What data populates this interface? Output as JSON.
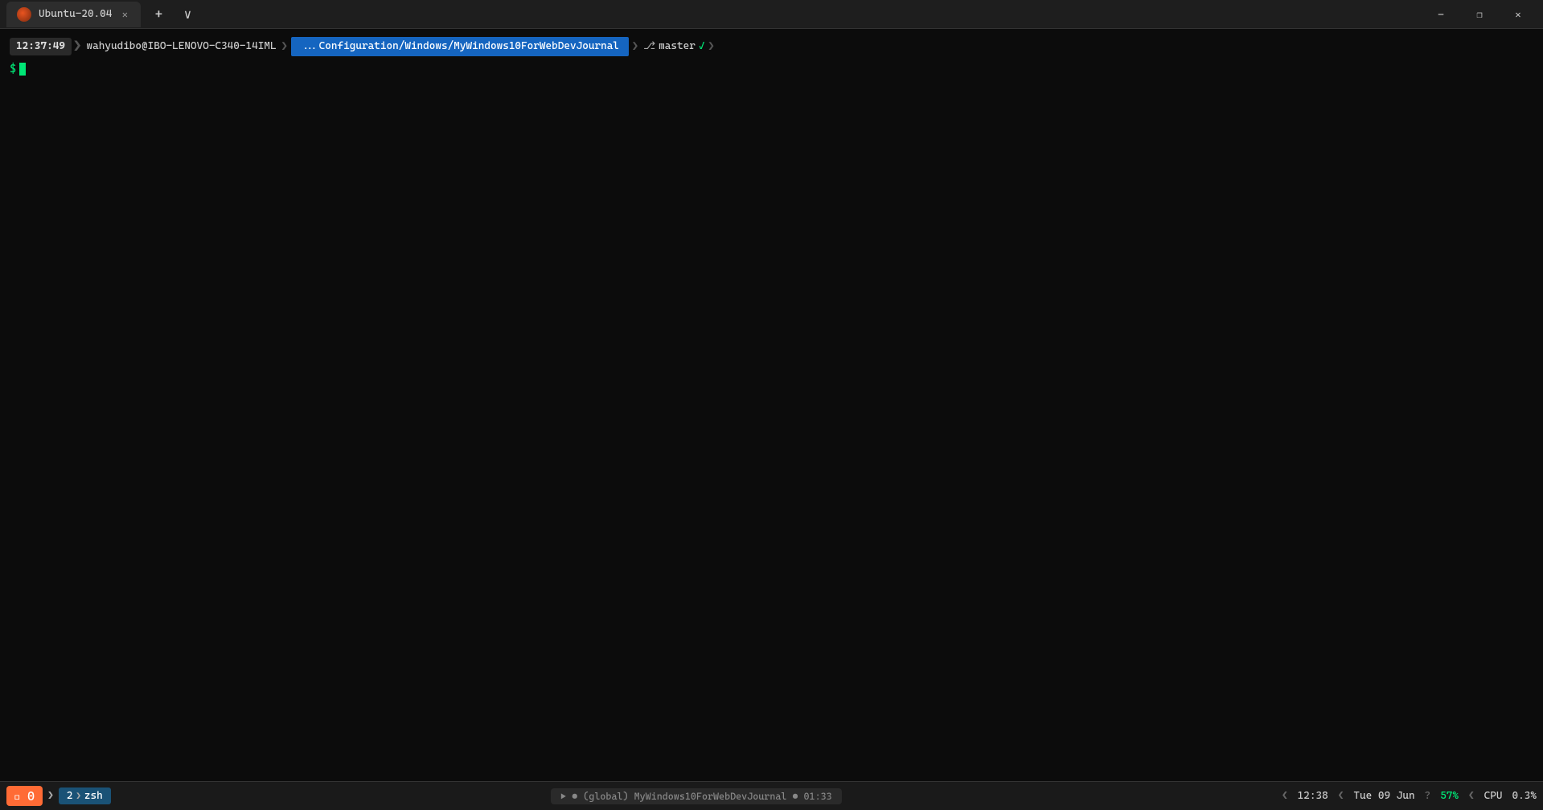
{
  "titlebar": {
    "tab_label": "Ubuntu-20.04",
    "new_tab_icon": "+",
    "dropdown_icon": "∨",
    "minimize_icon": "—",
    "maximize_icon": "❐",
    "close_icon": "✕"
  },
  "terminal": {
    "time": "12:37:49",
    "user_host": "wahyudibo@IBO-LENOVO-C340-14IML",
    "path": "...Configuration/Windows/MyWindows10ForWebDevJournal",
    "path_separator": "❯",
    "git_branch": "master",
    "git_status": "✓",
    "git_icon": "",
    "prompt_symbol": "$"
  },
  "statusbar": {
    "window_num": "0",
    "pane_num": "2",
    "shell": "zsh",
    "center_text": "",
    "time": "12:38",
    "date": "Tue 09 Jun",
    "battery_pct": "57%",
    "cpu_label": "CPU",
    "cpu_pct": "0.3%"
  }
}
